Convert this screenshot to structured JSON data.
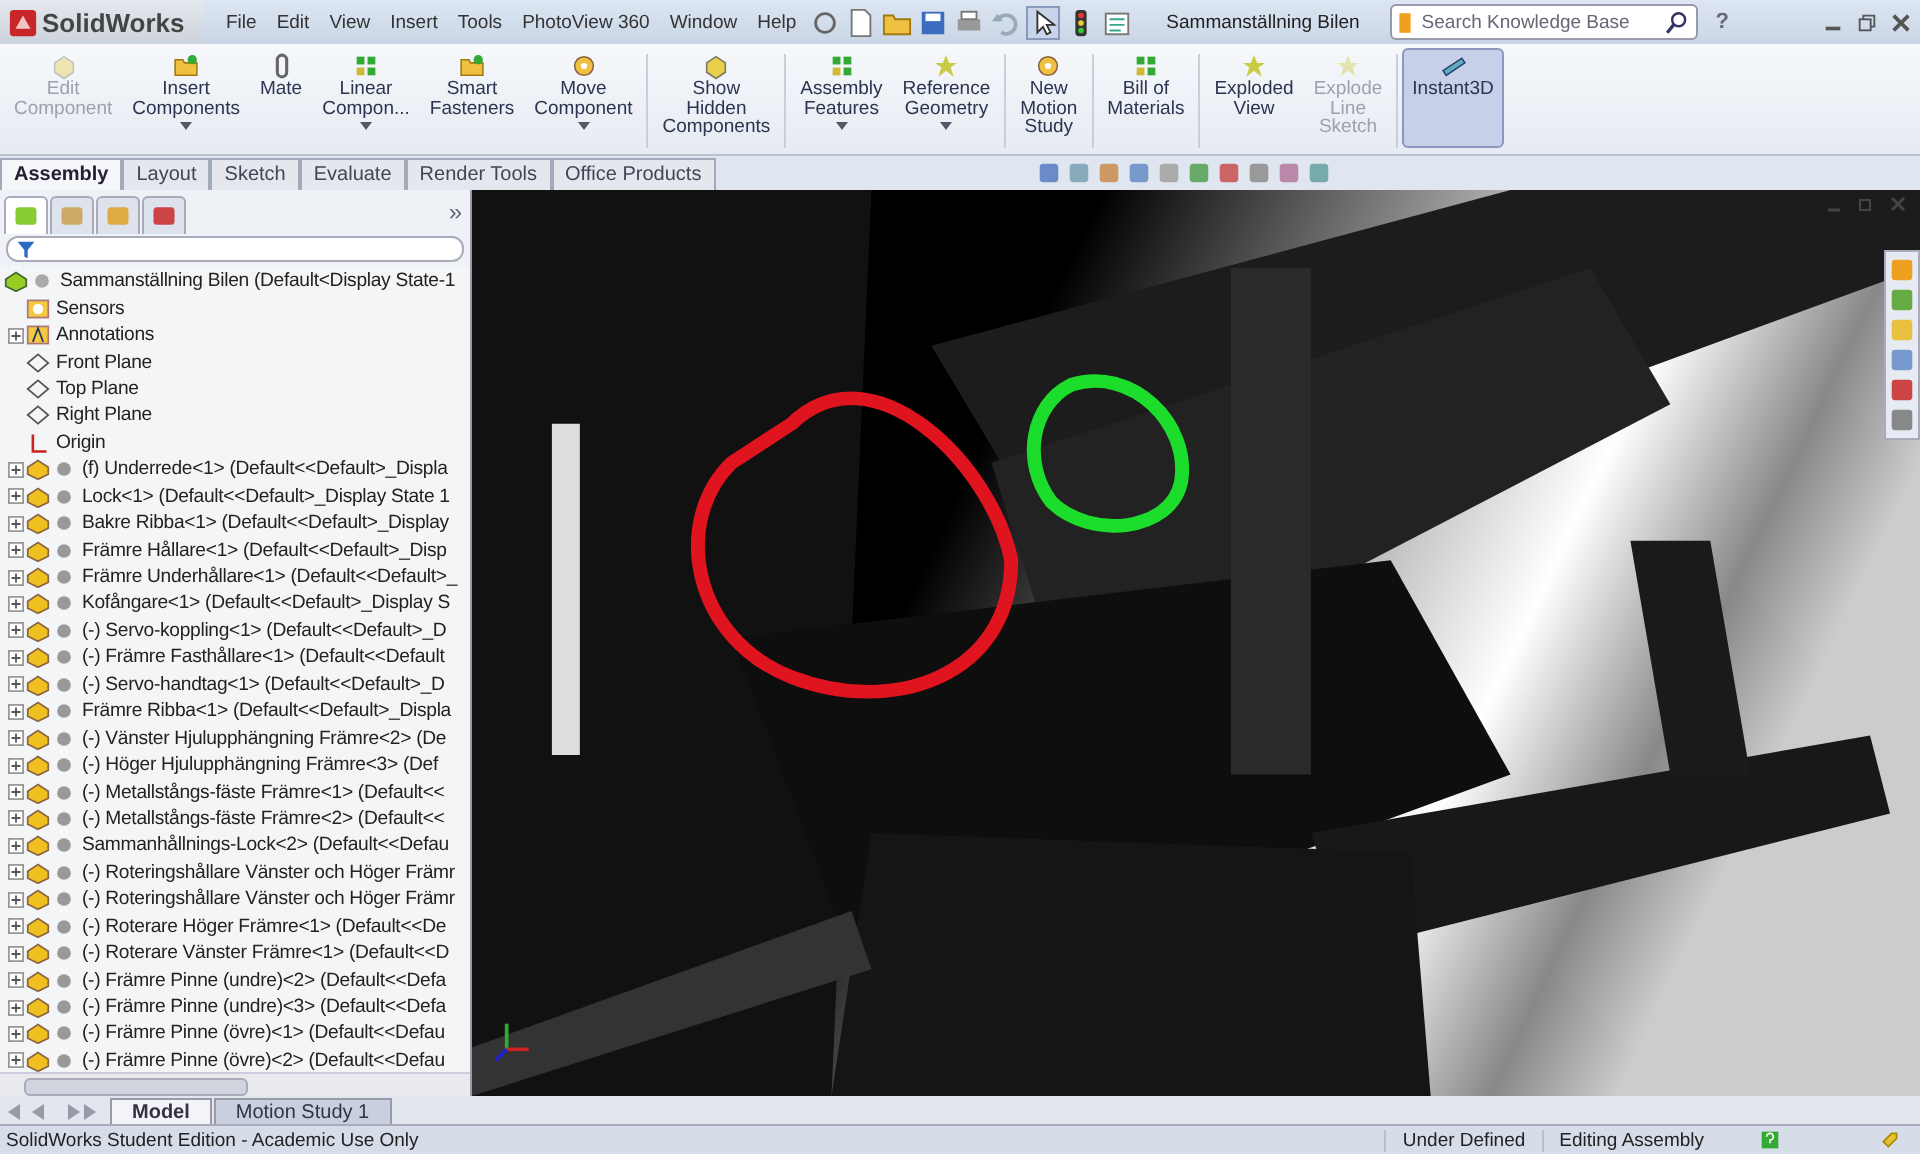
{
  "app": {
    "name": "SolidWorks"
  },
  "menu": [
    "File",
    "Edit",
    "View",
    "Insert",
    "Tools",
    "PhotoView 360",
    "Window",
    "Help"
  ],
  "document_title": "Sammanställning Bilen",
  "search": {
    "placeholder": "Search Knowledge Base"
  },
  "help_label": "?",
  "ribbon": {
    "groups": [
      [
        {
          "label": "Edit Component",
          "disabled": true,
          "dropdown": false,
          "selected": false
        },
        {
          "label": "Insert Components",
          "disabled": false,
          "dropdown": true,
          "selected": false
        },
        {
          "label": "Mate",
          "disabled": false,
          "dropdown": false,
          "selected": false
        },
        {
          "label": "Linear Compon...",
          "disabled": false,
          "dropdown": true,
          "selected": false
        },
        {
          "label": "Smart Fasteners",
          "disabled": false,
          "dropdown": false,
          "selected": false
        },
        {
          "label": "Move Component",
          "disabled": false,
          "dropdown": true,
          "selected": false
        }
      ],
      [
        {
          "label": "Show Hidden Components",
          "disabled": false,
          "dropdown": false,
          "selected": false
        }
      ],
      [
        {
          "label": "Assembly Features",
          "disabled": false,
          "dropdown": true,
          "selected": false
        },
        {
          "label": "Reference Geometry",
          "disabled": false,
          "dropdown": true,
          "selected": false
        }
      ],
      [
        {
          "label": "New Motion Study",
          "disabled": false,
          "dropdown": false,
          "selected": false
        }
      ],
      [
        {
          "label": "Bill of Materials",
          "disabled": false,
          "dropdown": false,
          "selected": false
        }
      ],
      [
        {
          "label": "Exploded View",
          "disabled": false,
          "dropdown": false,
          "selected": false
        },
        {
          "label": "Explode Line Sketch",
          "disabled": true,
          "dropdown": false,
          "selected": false
        }
      ],
      [
        {
          "label": "Instant3D",
          "disabled": false,
          "dropdown": false,
          "selected": true
        }
      ]
    ]
  },
  "command_tabs": [
    {
      "label": "Assembly",
      "selected": true
    },
    {
      "label": "Layout",
      "selected": false
    },
    {
      "label": "Sketch",
      "selected": false
    },
    {
      "label": "Evaluate",
      "selected": false
    },
    {
      "label": "Render Tools",
      "selected": false
    },
    {
      "label": "Office Products",
      "selected": false
    }
  ],
  "panel_tabs": [
    {
      "selected": true
    },
    {
      "selected": false
    },
    {
      "selected": false
    },
    {
      "selected": false
    }
  ],
  "panel_expand": "»",
  "tree": {
    "label": "Sammanställning Bilen  (Default<Display State-1",
    "children": [
      {
        "kind": "sensors",
        "label": "Sensors",
        "expandable": false
      },
      {
        "kind": "annotations",
        "label": "Annotations",
        "expandable": true
      },
      {
        "kind": "plane",
        "label": "Front Plane",
        "expandable": false
      },
      {
        "kind": "plane",
        "label": "Top Plane",
        "expandable": false
      },
      {
        "kind": "plane",
        "label": "Right Plane",
        "expandable": false
      },
      {
        "kind": "origin",
        "label": "Origin",
        "expandable": false
      },
      {
        "kind": "component",
        "label": "(f) Underrede<1> (Default<<Default>_Displa",
        "expandable": true
      },
      {
        "kind": "component",
        "label": "Lock<1> (Default<<Default>_Display State 1",
        "expandable": true
      },
      {
        "kind": "component",
        "label": "Bakre Ribba<1> (Default<<Default>_Display",
        "expandable": true
      },
      {
        "kind": "component",
        "label": "Främre Hållare<1> (Default<<Default>_Disp",
        "expandable": true
      },
      {
        "kind": "component",
        "label": "Främre Underhållare<1> (Default<<Default>_",
        "expandable": true
      },
      {
        "kind": "component",
        "label": "Kofångare<1> (Default<<Default>_Display S",
        "expandable": true
      },
      {
        "kind": "component",
        "label": "(-) Servo-koppling<1> (Default<<Default>_D",
        "expandable": true
      },
      {
        "kind": "component",
        "label": "(-) Främre Fasthållare<1> (Default<<Default",
        "expandable": true
      },
      {
        "kind": "component",
        "label": "(-) Servo-handtag<1> (Default<<Default>_D",
        "expandable": true
      },
      {
        "kind": "component",
        "label": "Främre Ribba<1> (Default<<Default>_Displa",
        "expandable": true
      },
      {
        "kind": "component",
        "label": "(-) Vänster Hjulupphängning Främre<2> (De",
        "expandable": true
      },
      {
        "kind": "component",
        "label": "(-) Höger Hjulupphängning Främre<3> (Def",
        "expandable": true
      },
      {
        "kind": "component",
        "label": "(-) Metallstångs-fäste Främre<1> (Default<<",
        "expandable": true
      },
      {
        "kind": "component",
        "label": "(-) Metallstångs-fäste Främre<2> (Default<<",
        "expandable": true
      },
      {
        "kind": "component",
        "label": "Sammanhållnings-Lock<2> (Default<<Defau",
        "expandable": true
      },
      {
        "kind": "component",
        "label": "(-) Roteringshållare Vänster och Höger Främr",
        "expandable": true
      },
      {
        "kind": "component",
        "label": "(-) Roteringshållare Vänster och Höger Främr",
        "expandable": true
      },
      {
        "kind": "component",
        "label": "(-) Roterare Höger Främre<1> (Default<<De",
        "expandable": true
      },
      {
        "kind": "component",
        "label": "(-) Roterare Vänster Främre<1> (Default<<D",
        "expandable": true
      },
      {
        "kind": "component",
        "label": "(-) Främre Pinne (undre)<2> (Default<<Defa",
        "expandable": true
      },
      {
        "kind": "component",
        "label": "(-) Främre Pinne (undre)<3> (Default<<Defa",
        "expandable": true
      },
      {
        "kind": "component",
        "label": "(-) Främre Pinne (övre)<1> (Default<<Defau",
        "expandable": true
      },
      {
        "kind": "component",
        "label": "(-) Främre Pinne (övre)<2> (Default<<Defau",
        "expandable": true
      }
    ]
  },
  "bottom_tabs": [
    {
      "label": "Model",
      "selected": true
    },
    {
      "label": "Motion Study 1",
      "selected": false
    }
  ],
  "status_bar": {
    "edition": "SolidWorks Student Edition - Academic Use Only",
    "state": "Under Defined",
    "mode": "Editing Assembly"
  }
}
